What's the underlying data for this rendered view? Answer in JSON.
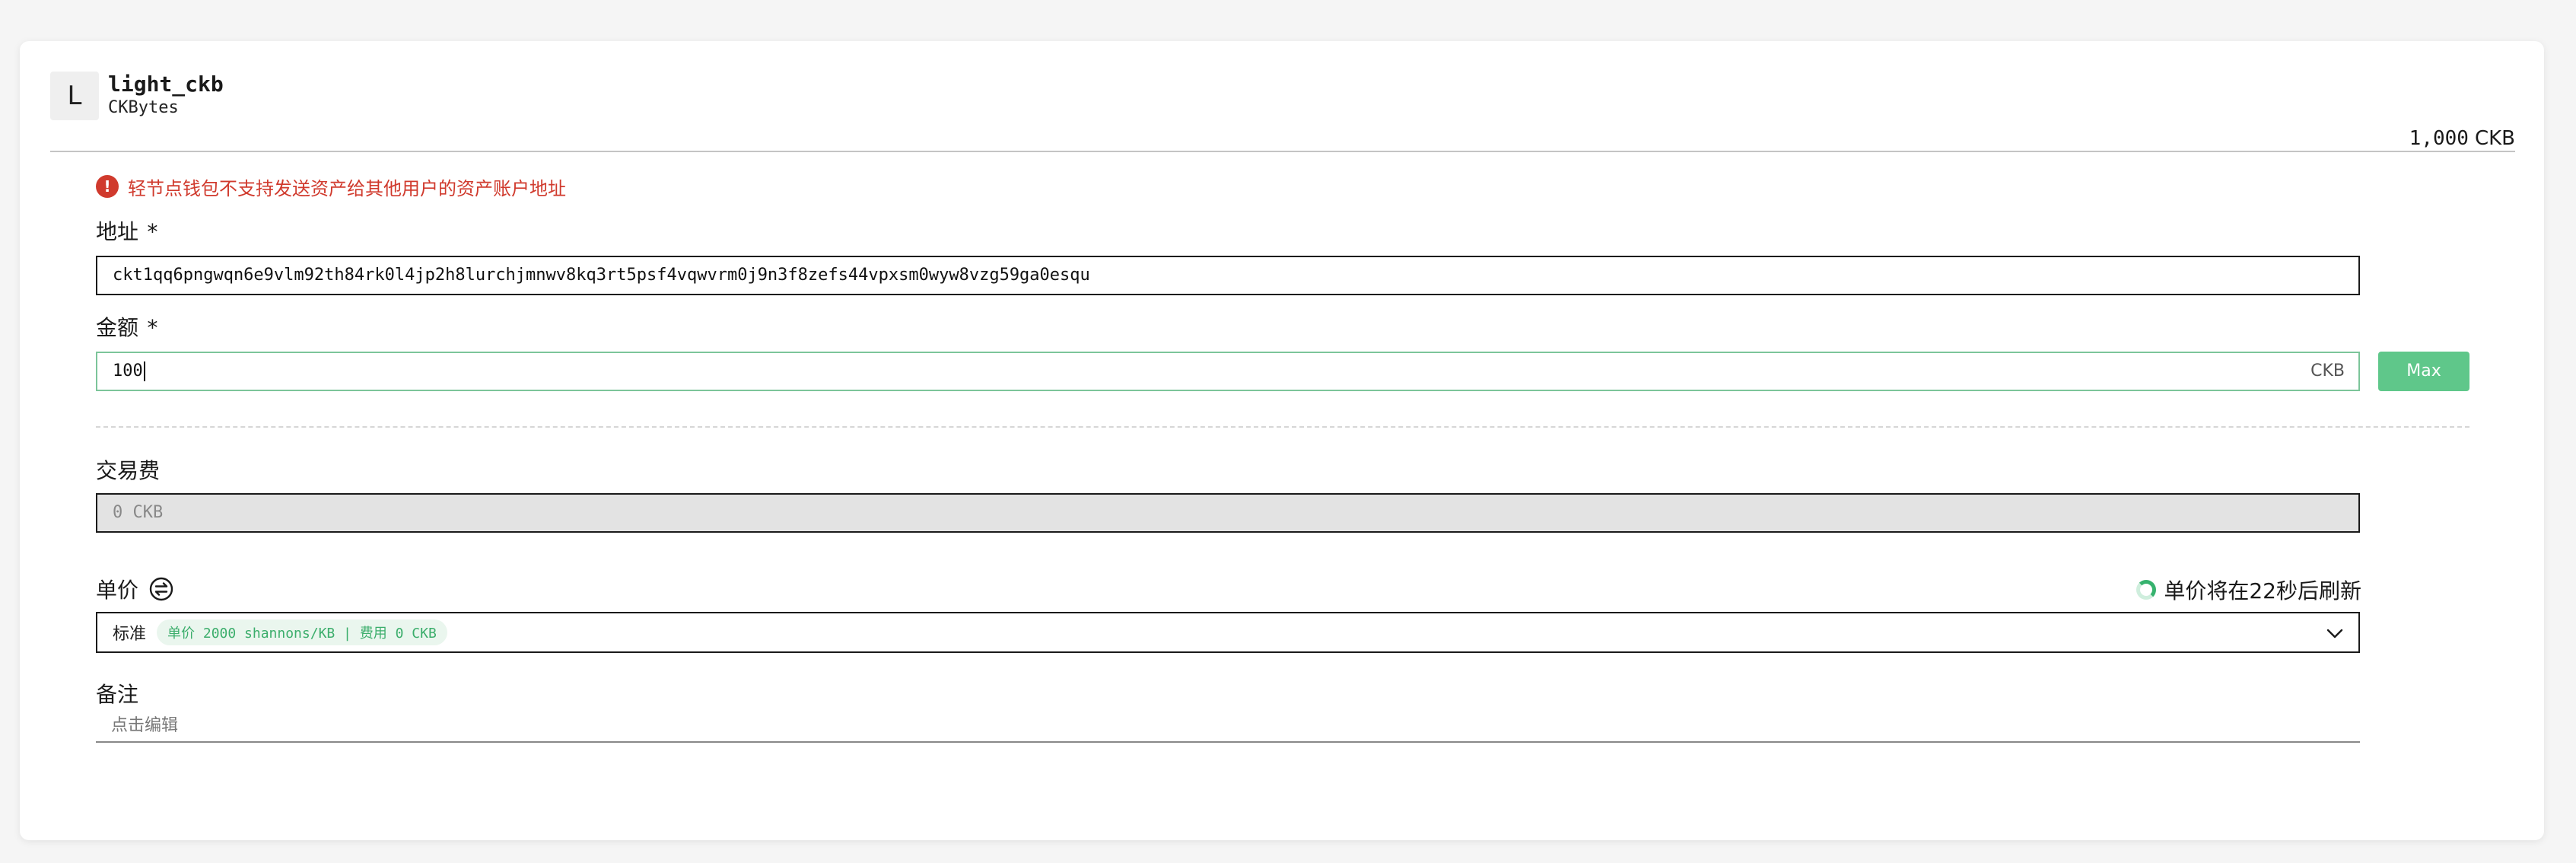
{
  "asset": {
    "avatar_letter": "L",
    "name": "light_ckb",
    "symbol": "CKBytes",
    "balance": "1,000",
    "balance_unit": "CKB"
  },
  "warning": {
    "icon": "exclamation-circle-icon",
    "text": "轻节点钱包不支持发送资产给其他用户的资产账户地址",
    "color": "#d03a2d"
  },
  "form": {
    "address": {
      "label": "地址",
      "required_mark": "*",
      "value": "ckt1qq6pngwqn6e9vlm92th84rk0l4jp2h8lurchjmnwv8kq3rt5psf4vqwvrm0j9n3f8zefs44vpxsm0wyw8vzg59ga0esqu"
    },
    "amount": {
      "label": "金额",
      "required_mark": "*",
      "value": "100",
      "unit": "CKB",
      "max_label": "Max"
    },
    "fee": {
      "label": "交易费",
      "value": "0 CKB"
    },
    "price": {
      "label": "单价",
      "switch_icon": "swap-icon",
      "refresh_text": "单价将在22秒后刷新",
      "selected": "标准",
      "tag": "单价 2000 shannons/KB | 费用 0 CKB"
    },
    "note": {
      "label": "备注",
      "placeholder": "点击编辑"
    }
  },
  "colors": {
    "accent": "#5fc78a",
    "warning": "#d03a2d"
  }
}
